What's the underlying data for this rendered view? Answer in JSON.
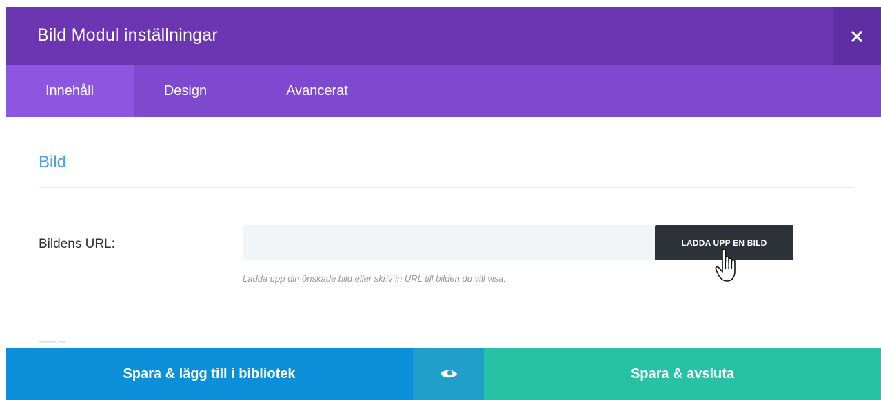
{
  "modal": {
    "title": "Bild Modul inställningar",
    "close_icon": "close-icon"
  },
  "tabs": [
    {
      "label": "Innehåll",
      "active": true
    },
    {
      "label": "Design",
      "active": false
    },
    {
      "label": "Avancerat",
      "active": false
    }
  ],
  "section": {
    "title": "Bild"
  },
  "image_url_field": {
    "label": "Bildens URL:",
    "value": "",
    "placeholder": "",
    "upload_button_label": "LADDA UPP EN BILD",
    "help_text": "Ladda upp din önskade bild eller skriv in URL till bilden du vill visa."
  },
  "footer": {
    "save_library_label": "Spara & lägg till i bibliotek",
    "preview_icon": "eye-icon",
    "save_exit_label": "Spara & avsluta"
  },
  "colors": {
    "header": "#6c36b3",
    "tabs": "#7e48cf",
    "active_tab": "#8c56e0",
    "section_title": "#4aa3d9",
    "save_library": "#0b8fd8",
    "preview": "#1f9fc9",
    "save_exit": "#27c2a5"
  }
}
